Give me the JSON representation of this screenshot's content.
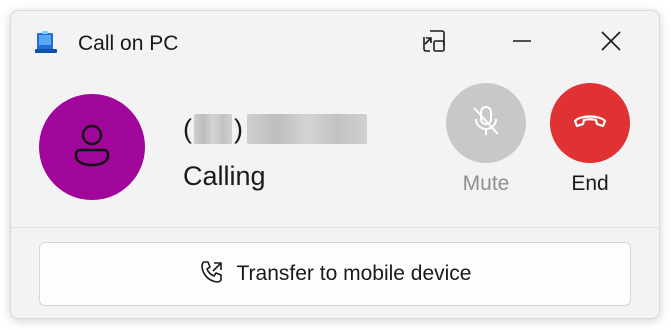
{
  "window": {
    "title": "Call on PC",
    "app_icon": "phone-link-icon",
    "controls": {
      "compact_icon": "compact-overlay-icon",
      "minimize_icon": "minimize-icon",
      "close_icon": "close-icon"
    }
  },
  "caller": {
    "avatar_icon": "person-icon",
    "avatar_color": "#a1069a",
    "name_open_paren": "(",
    "name_close_paren": ")",
    "status": "Calling"
  },
  "actions": {
    "mute": {
      "label": "Mute",
      "icon": "microphone-off-icon",
      "enabled": false,
      "color": "#c8c8c8"
    },
    "end": {
      "label": "End",
      "icon": "hang-up-icon",
      "color": "#e03232"
    }
  },
  "transfer": {
    "label": "Transfer to mobile device",
    "icon": "phone-transfer-icon"
  }
}
